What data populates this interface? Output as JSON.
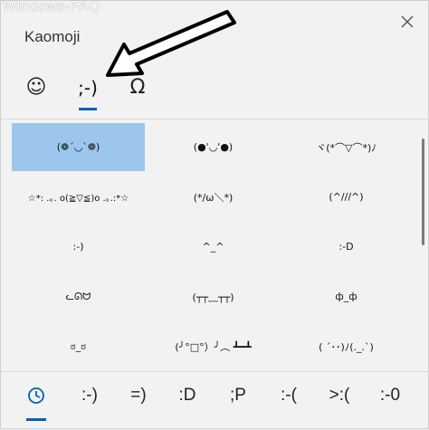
{
  "watermark": "Windows-FAQ",
  "window": {
    "title": "Kaomoji",
    "close_icon": "close-icon"
  },
  "tabs": [
    {
      "name": "emoji",
      "label": "☺"
    },
    {
      "name": "kaomoji",
      "label": ";-)"
    },
    {
      "name": "symbols",
      "label": "Ω"
    }
  ],
  "kaomoji": [
    "(❁´◡`❁)",
    "(●'◡'●)",
    "ヾ(*⌒▽⌒*)ﾉ",
    "☆*: .｡. o(≧▽≦)o .｡.:*☆",
    "(*/ω＼*)",
    "(^///^)",
    ":-)",
    "^_^",
    ":-D",
    "ᓚᘏᗢ",
    "(┬┬﹏┬┬)",
    "ф_ф",
    "ಠ_ಠ",
    "(╯°□°）╯︵ ┻━┻",
    "( ´･･)ﾉ(._.`)"
  ],
  "bottom": {
    "recent_icon": "clock-icon",
    "items": [
      ":-)",
      "=)",
      ":D",
      ";P",
      ":-(",
      ">:(",
      ":-0"
    ]
  },
  "colors": {
    "accent": "#0063b1",
    "selected": "#9cc6ec"
  }
}
